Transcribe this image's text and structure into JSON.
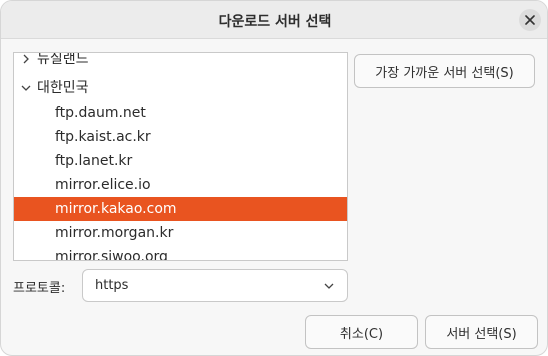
{
  "window": {
    "title": "다운로드 서버 선택"
  },
  "server_tree": {
    "partial_group": {
      "label": "뉴질랜드",
      "expanded": false
    },
    "group": {
      "label": "대한민국",
      "expanded": true
    },
    "items": [
      "ftp.daum.net",
      "ftp.kaist.ac.kr",
      "ftp.lanet.kr",
      "mirror.elice.io",
      "mirror.kakao.com",
      "mirror.morgan.kr",
      "mirror.siwoo.org"
    ],
    "selected": "mirror.kakao.com"
  },
  "buttons": {
    "nearest": "가장 가까운 서버 선택(S)",
    "cancel": "취소(C)",
    "select": "서버 선택(S)"
  },
  "protocol": {
    "label": "프로토콜:",
    "value": "https"
  },
  "colors": {
    "selection": "#e95420"
  },
  "icons": {
    "close": "close-icon",
    "expand": "chevron-right-icon",
    "collapse": "chevron-down-icon",
    "dropdown": "chevron-down-icon"
  }
}
